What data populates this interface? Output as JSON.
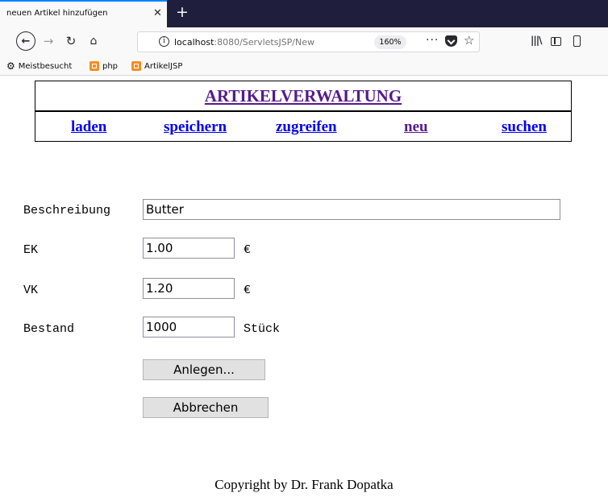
{
  "browser": {
    "tab_title": "neuen Artikel hinzufügen",
    "url_host": "localhost",
    "url_path": ":8080/ServletsJSP/New",
    "zoom": "160%",
    "url_dots": "···",
    "bookmarks": [
      "Meistbesucht",
      "php",
      "ArtikelJSP"
    ],
    "icons": [
      "close-icon",
      "plus-icon",
      "back-arrow-icon",
      "forward-arrow-icon",
      "reload-icon",
      "home-icon",
      "info-icon",
      "pocket-icon",
      "star-icon",
      "library-icon",
      "sidebar-icon",
      "menu-icon",
      "gear-icon",
      "bookmark-favicon"
    ]
  },
  "header": {
    "title": "ARTIKELVERWALTUNG",
    "nav": [
      {
        "label": "laden",
        "color": "#0000ee"
      },
      {
        "label": "speichern",
        "color": "#0000ee"
      },
      {
        "label": "zugreifen",
        "color": "#0000ee"
      },
      {
        "label": "neu",
        "color": "#551a8b"
      },
      {
        "label": "suchen",
        "color": "#0000ee"
      }
    ]
  },
  "form": {
    "beschreibung": {
      "label": "Beschreibung",
      "value": "Butter"
    },
    "ek": {
      "label": "EK",
      "value": "1.00",
      "unit": "€"
    },
    "vk": {
      "label": "VK",
      "value": "1.20",
      "unit": "€"
    },
    "bestand": {
      "label": "Bestand",
      "value": "1000",
      "unit": "Stück"
    },
    "submit_label": "Anlegen...",
    "cancel_label": "Abbrechen"
  },
  "footer": {
    "copyright": "Copyright by Dr. Frank Dopatka"
  },
  "colors": {
    "tabbar_bg": "#1f1f3d",
    "link_visited": "#551a8b",
    "link": "#0000ee"
  }
}
